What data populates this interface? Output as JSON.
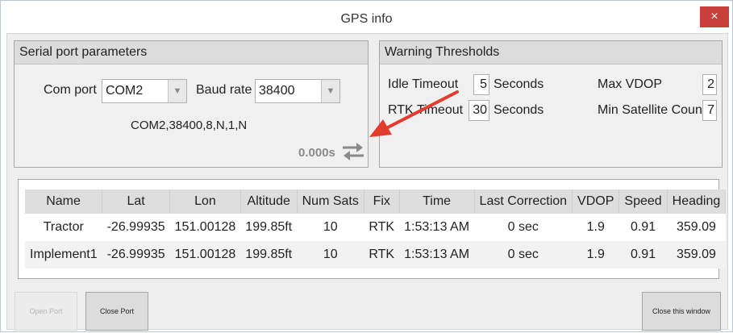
{
  "window": {
    "title": "GPS info",
    "close_glyph": "×"
  },
  "serial": {
    "header": "Serial port parameters",
    "com_port_label": "Com port",
    "com_port_value": "COM2",
    "baud_label": "Baud rate",
    "baud_value": "38400",
    "summary": "COM2,38400,8,N,1,N",
    "timer": "0.000s",
    "swap_icon": "swap-arrows-icon"
  },
  "thresholds": {
    "header": "Warning Thresholds",
    "idle_label": "Idle Timeout",
    "idle_value": "5",
    "idle_unit": "Seconds",
    "rtk_label": "RTK Timeout",
    "rtk_value": "30",
    "rtk_unit": "Seconds",
    "vdop_label": "Max VDOP",
    "vdop_value": "2",
    "sat_label": "Min Satellite Count",
    "sat_value": "7"
  },
  "table": {
    "columns": [
      "Name",
      "Lat",
      "Lon",
      "Altitude",
      "Num Sats",
      "Fix",
      "Time",
      "Last Correction",
      "VDOP",
      "Speed",
      "Heading"
    ],
    "rows": [
      [
        "Tractor",
        "-26.99935",
        "151.00128",
        "199.85ft",
        "10",
        "RTK",
        "1:53:13 AM",
        "0 sec",
        "1.9",
        "0.91",
        "359.09"
      ],
      [
        "Implement1",
        "-26.99935",
        "151.00128",
        "199.85ft",
        "10",
        "RTK",
        "1:53:13 AM",
        "0 sec",
        "1.9",
        "0.91",
        "359.09"
      ]
    ]
  },
  "buttons": {
    "open_port": "Open Port",
    "close_port": "Close Port",
    "close_window": "Close this window"
  },
  "colors": {
    "close": "#c9403a",
    "annotation_arrow": "#e33b2e"
  }
}
